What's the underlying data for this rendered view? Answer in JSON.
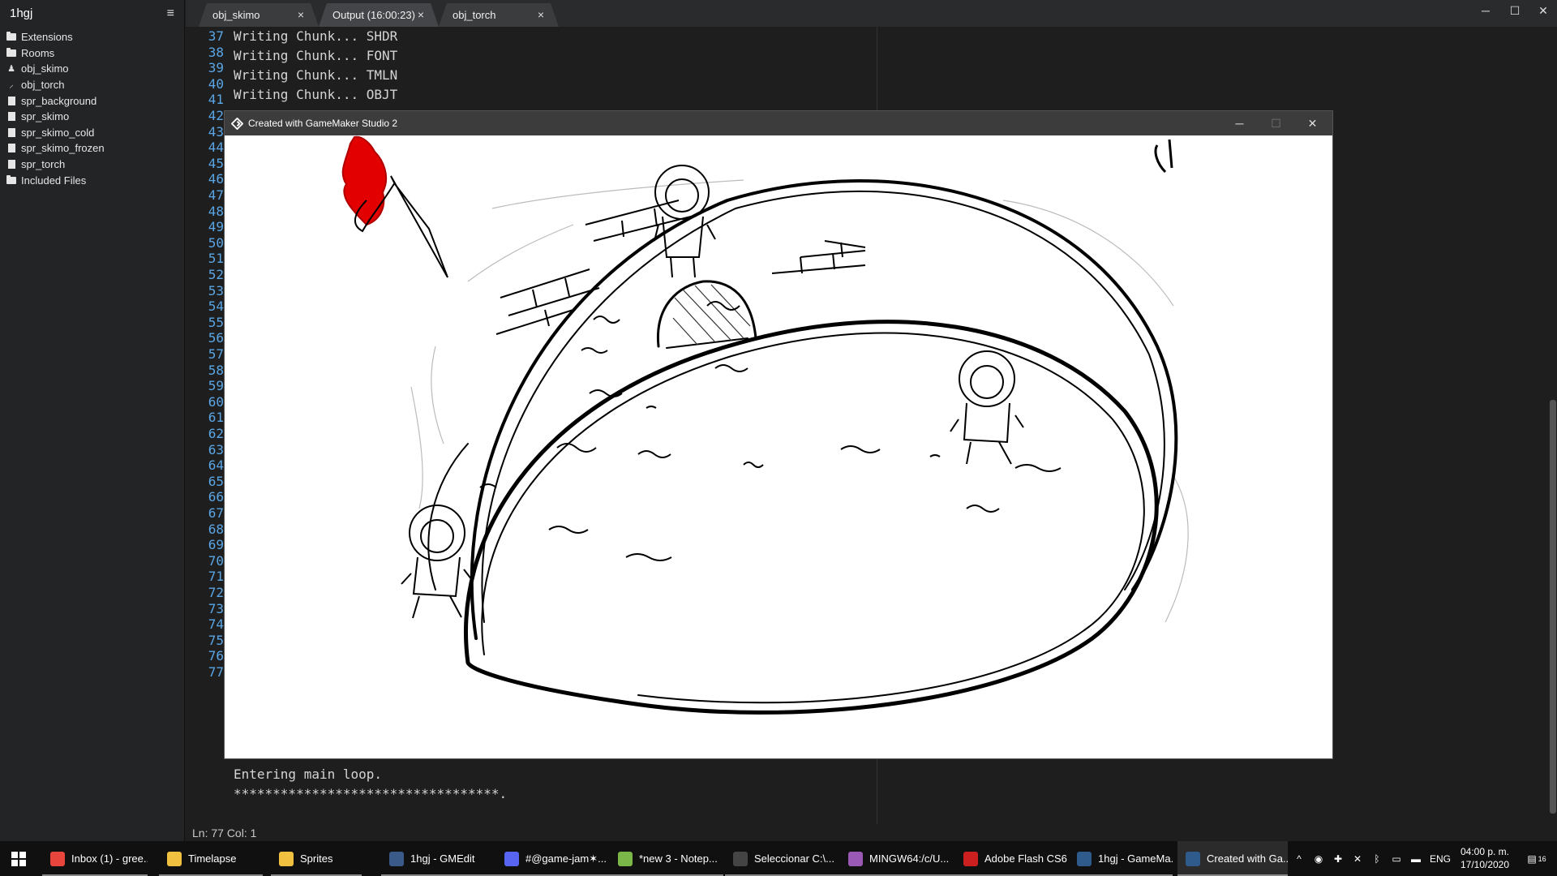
{
  "sidebar": {
    "project_title": "1hgj",
    "menu_icon": "hamburger-icon",
    "items": [
      {
        "label": "Extensions",
        "icon": "folder-icon"
      },
      {
        "label": "Rooms",
        "icon": "folder-icon"
      },
      {
        "label": "obj_skimo",
        "icon": "object-icon"
      },
      {
        "label": "obj_torch",
        "icon": "object-icon"
      },
      {
        "label": "spr_background",
        "icon": "file-icon"
      },
      {
        "label": "spr_skimo",
        "icon": "file-icon"
      },
      {
        "label": "spr_skimo_cold",
        "icon": "file-icon"
      },
      {
        "label": "spr_skimo_frozen",
        "icon": "file-icon"
      },
      {
        "label": "spr_torch",
        "icon": "file-icon"
      },
      {
        "label": "Included Files",
        "icon": "folder-icon"
      }
    ]
  },
  "tabs": [
    {
      "label": "obj_skimo",
      "close": "×"
    },
    {
      "label": "Output (16:00:23)",
      "close": "×"
    },
    {
      "label": "obj_torch",
      "close": "×"
    }
  ],
  "window_controls": {
    "minimize": "─",
    "maximize": "☐",
    "close": "✕"
  },
  "editor": {
    "line_numbers": [
      "37",
      "38",
      "39",
      "40",
      "41",
      "42",
      "43",
      "44",
      "45",
      "46",
      "47",
      "48",
      "49",
      "50",
      "51",
      "52",
      "53",
      "54",
      "55",
      "56",
      "57",
      "58",
      "59",
      "60",
      "61",
      "62",
      "63",
      "64",
      "65",
      "66",
      "67",
      "68",
      "69",
      "70",
      "71",
      "72",
      "73",
      "74",
      "75",
      "76",
      "77"
    ],
    "top_lines": [
      "Writing Chunk... SHDR",
      "Writing Chunk... FONT",
      "Writing Chunk... TMLN",
      "Writing Chunk... OBJT"
    ],
    "bottom_lines": [
      "Entering main loop.",
      "**********************************."
    ]
  },
  "status": {
    "text": "Ln:  77 Col:   1"
  },
  "game_window": {
    "title": "Created with GameMaker Studio 2",
    "minimize": "─",
    "maximize": "☐",
    "close": "✕"
  },
  "taskbar": {
    "start_icon": "windows-logo-icon",
    "items": [
      {
        "label": "Inbox (1) - gree...",
        "icon": "chrome-icon",
        "color": "#e8453c"
      },
      {
        "label": "Timelapse",
        "icon": "folder-icon",
        "color": "#f0c040"
      },
      {
        "label": "Sprites",
        "icon": "folder-icon",
        "color": "#f0c040"
      },
      {
        "label": "1hgj - GMEdit",
        "icon": "gmedit-icon",
        "color": "#3a5a8a"
      },
      {
        "label": "#@game-jam✶...",
        "icon": "discord-icon",
        "color": "#5865f2"
      },
      {
        "label": "*new 3 - Notep...",
        "icon": "notepad-icon",
        "color": "#7ab648"
      },
      {
        "label": "Seleccionar C:\\...",
        "icon": "console-icon",
        "color": "#444"
      },
      {
        "label": "MINGW64:/c/U...",
        "icon": "git-icon",
        "color": "#9b59b6"
      },
      {
        "label": "Adobe Flash CS6",
        "icon": "flash-icon",
        "color": "#cc1f1f"
      },
      {
        "label": "1hgj - GameMa...",
        "icon": "gamemaker-icon",
        "color": "#2e5a8c"
      },
      {
        "label": "Created with Ga...",
        "icon": "gamemaker-icon",
        "color": "#2e5a8c"
      }
    ],
    "tray": {
      "language": "ENG",
      "time": "04:00 p. m.",
      "date": "17/10/2020",
      "notifications": "16",
      "chevron": "^"
    }
  }
}
